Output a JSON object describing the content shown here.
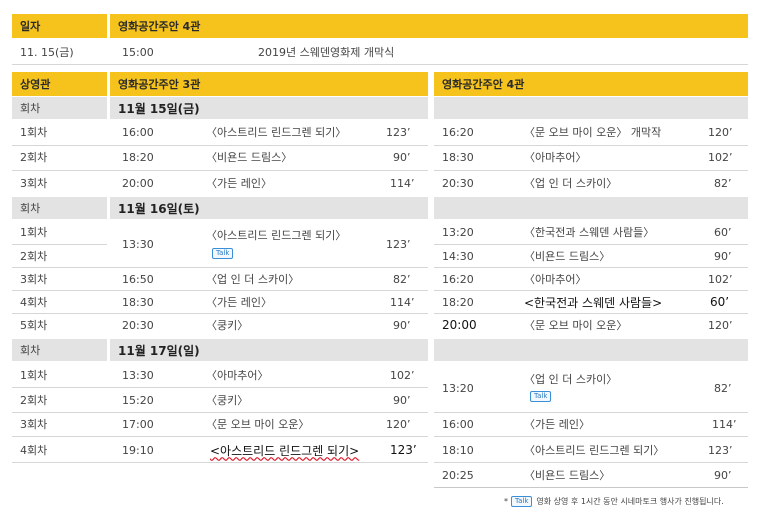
{
  "top_header": {
    "col1": "일자",
    "col2": "영화공간주안 4관"
  },
  "top_row": {
    "date": "11. 15(금)",
    "time": "15:00",
    "event": "2019년 스웨덴영화제 개막식"
  },
  "schedule_header": {
    "hall": "상영관",
    "left": "영화공간주안 3관",
    "right": "영화공간주안 4관"
  },
  "days": [
    {
      "label": "회차",
      "date": "11월 15일(금)",
      "left": [
        {
          "round": "1회차",
          "time": "16:00",
          "title": "〈아스트리드 린드그렌 되기〉",
          "min": "123’"
        },
        {
          "round": "2회차",
          "time": "18:20",
          "title": "〈비욘드 드림스〉",
          "min": "90’"
        },
        {
          "round": "3회차",
          "time": "20:00",
          "title": "〈가든 레인〉",
          "min": "114’"
        }
      ],
      "right": [
        {
          "time": "16:20",
          "title": "〈문 오브 마이 오운〉 개막작",
          "min": "120’"
        },
        {
          "time": "18:30",
          "title": "〈아마추어〉",
          "min": "102’"
        },
        {
          "time": "20:30",
          "title": "〈업 인 더 스카이〉",
          "min": "82’"
        }
      ]
    },
    {
      "label": "회차",
      "date": "11월 16일(토)",
      "left_rounds": [
        "1회차",
        "2회차",
        "3회차",
        "4회차",
        "5회차"
      ],
      "left": [
        {
          "time": "13:30",
          "title": "〈아스트리드 린드그렌 되기〉",
          "min": "123’",
          "talk": "Talk"
        },
        {
          "time": "16:50",
          "title": "〈업 인 더 스카이〉",
          "min": "82’"
        },
        {
          "time": "18:30",
          "title": "〈가든 레인〉",
          "min": "114’"
        },
        {
          "time": "20:30",
          "title": "〈쿵키〉",
          "min": "90’"
        }
      ],
      "right": [
        {
          "time": "13:20",
          "title": "〈한국전과 스웨덴 사람들〉",
          "min": "60’"
        },
        {
          "time": "14:30",
          "title": "〈비욘드 드림스〉",
          "min": "90’"
        },
        {
          "time": "16:20",
          "title": "〈아마추어〉",
          "min": "102’"
        },
        {
          "time": "18:20",
          "title": "<한국전과 스웨덴 사람들>",
          "min": "60’"
        },
        {
          "time": "20:00",
          "title": "〈문 오브 마이 오운〉",
          "min": "120’"
        }
      ]
    },
    {
      "label": "회차",
      "date": "11월 17일(일)",
      "left": [
        {
          "round": "1회차",
          "time": "13:30",
          "title": "〈아마추어〉",
          "min": "102’"
        },
        {
          "round": "2회차",
          "time": "15:20",
          "title": "〈쿵키〉",
          "min": "90’"
        },
        {
          "round": "3회차",
          "time": "17:00",
          "title": "〈문 오브 마이 오운〉",
          "min": "120’"
        },
        {
          "round": "4회차",
          "time": "19:10",
          "title": "<아스트리드 린드그렌 되기>",
          "min": "123’"
        }
      ],
      "right": [
        {
          "time": "13:20",
          "title": "〈업 인 더 스카이〉",
          "min": "82’",
          "talk": "Talk"
        },
        {
          "time": "16:00",
          "title": "〈가든 레인〉",
          "min": "114’"
        },
        {
          "time": "18:10",
          "title": "〈아스트리드 린드그렌 되기〉",
          "min": "123’"
        },
        {
          "time": "20:25",
          "title": "〈비욘드 드림스〉",
          "min": "90’"
        }
      ]
    }
  ],
  "footnote": {
    "star": "*",
    "badge": "Talk",
    "text": "영화 상영 후 1시간 동안 시네마토크 행사가 진행됩니다."
  },
  "colors": {
    "accent": "#f5c31c",
    "section_gray": "#e3e3e3",
    "talk_blue": "#3a8fd6"
  }
}
